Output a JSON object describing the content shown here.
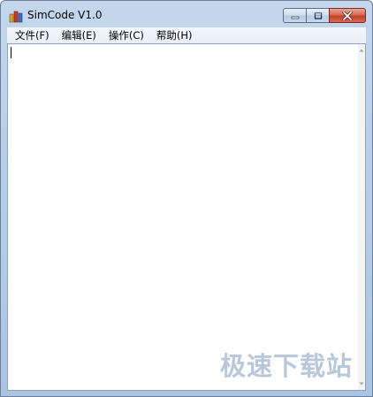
{
  "window": {
    "title": "SimCode V1.0"
  },
  "menu": {
    "items": [
      {
        "label": "文件(F)"
      },
      {
        "label": "编辑(E)"
      },
      {
        "label": "操作(C)"
      },
      {
        "label": "帮助(H)"
      }
    ]
  },
  "editor": {
    "content": ""
  },
  "watermark": {
    "text": "极速下载站"
  },
  "icons": {
    "app": "simcode-app-icon",
    "minimize": "minimize-icon",
    "maximize": "maximize-icon",
    "close": "close-icon",
    "scroll_up": "scroll-up-arrow-icon",
    "scroll_down": "scroll-down-arrow-icon"
  },
  "colors": {
    "titlebar": "#b8cfe8",
    "close_button": "#c2412b",
    "menubar": "#f0f4fa",
    "editor_bg": "#ffffff"
  }
}
